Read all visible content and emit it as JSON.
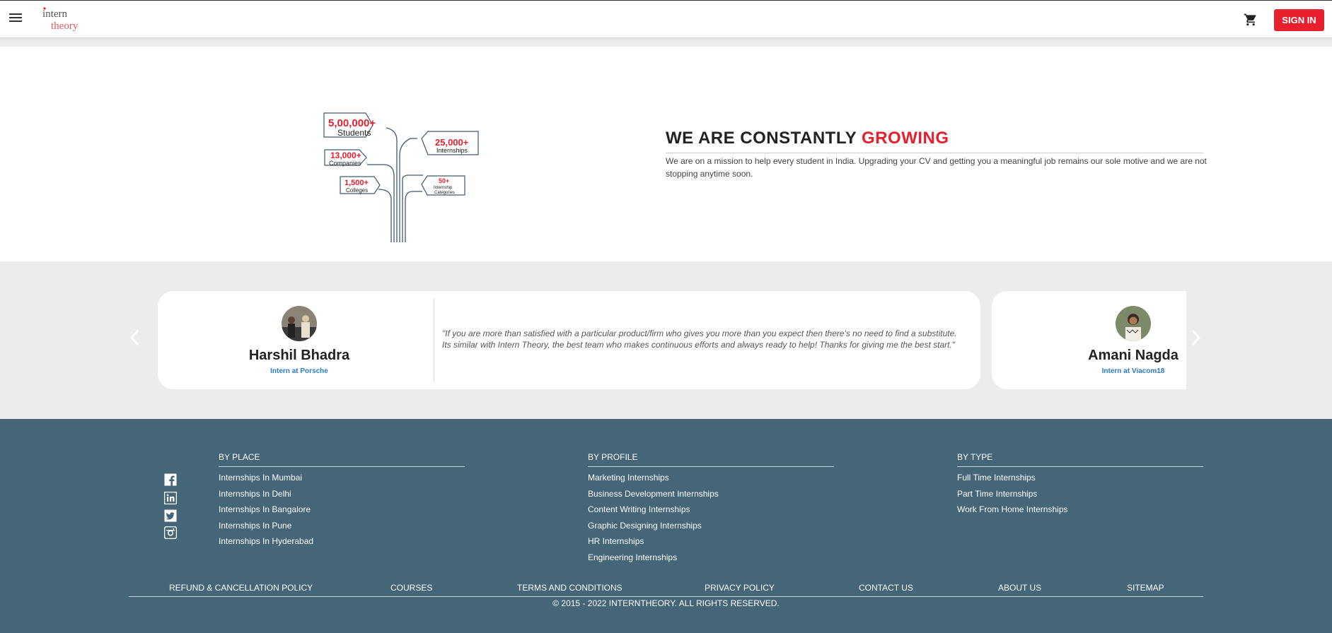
{
  "header": {
    "logo_text_top": "intern",
    "logo_text_bottom": "theory",
    "signin_label": "SIGN IN"
  },
  "growth": {
    "title_main": "WE ARE CONSTANTLY",
    "title_highlight": "GROWING",
    "description": "We are on a mission to help every student in India. Upgrading your CV and getting you a meaningful job remains our sole motive and we are not stopping anytime soon.",
    "stats": [
      {
        "value": "5,00,000+",
        "label": "Students"
      },
      {
        "value": "13,000+",
        "label": "Companies"
      },
      {
        "value": "1,500+",
        "label": "Colleges"
      },
      {
        "value": "25,000+",
        "label": "Internships"
      },
      {
        "value": "50+",
        "label": "Internship",
        "label2": "Categories"
      }
    ]
  },
  "testimonials": {
    "items": [
      {
        "name": "Harshil Bhadra",
        "role": "Intern at Porsche",
        "quote": "\"If you are more than satisfied with a particular product/firm who gives you more than you expect then there's no need to find a substitute. Its similar with Intern Theory, the best team who makes continuous efforts and always ready to help! Thanks for giving me the best start.\""
      },
      {
        "name": "Amani Nagda",
        "role": "Intern at Viacom18"
      }
    ]
  },
  "footer": {
    "columns": [
      {
        "title": "BY PLACE",
        "links": [
          "Internships In Mumbai",
          "Internships In Delhi",
          "Internships In Bangalore",
          "Internships In Pune",
          "Internships In Hyderabad"
        ]
      },
      {
        "title": "BY PROFILE",
        "links": [
          "Marketing Internships",
          "Business Development Internships",
          "Content Writing Internships",
          "Graphic Designing Internships",
          "HR Internships",
          "Engineering Internships"
        ]
      },
      {
        "title": "BY TYPE",
        "links": [
          "Full Time Internships",
          "Part Time Internships",
          "Work From Home Internships"
        ]
      }
    ],
    "bottom_links": [
      "REFUND & CANCELLATION POLICY",
      "COURSES",
      "TERMS AND CONDITIONS",
      "PRIVACY POLICY",
      "CONTACT US",
      "ABOUT US",
      "SITEMAP"
    ],
    "copyright": "© 2015 - 2022 INTERNTHEORY. ALL RIGHTS RESERVED.",
    "social_icons": [
      "facebook-icon",
      "linkedin-icon",
      "twitter-icon",
      "instagram-icon"
    ]
  },
  "colors": {
    "accent": "#e8202e",
    "footer_bg": "#456579",
    "link_blue": "#2a7bc9"
  }
}
